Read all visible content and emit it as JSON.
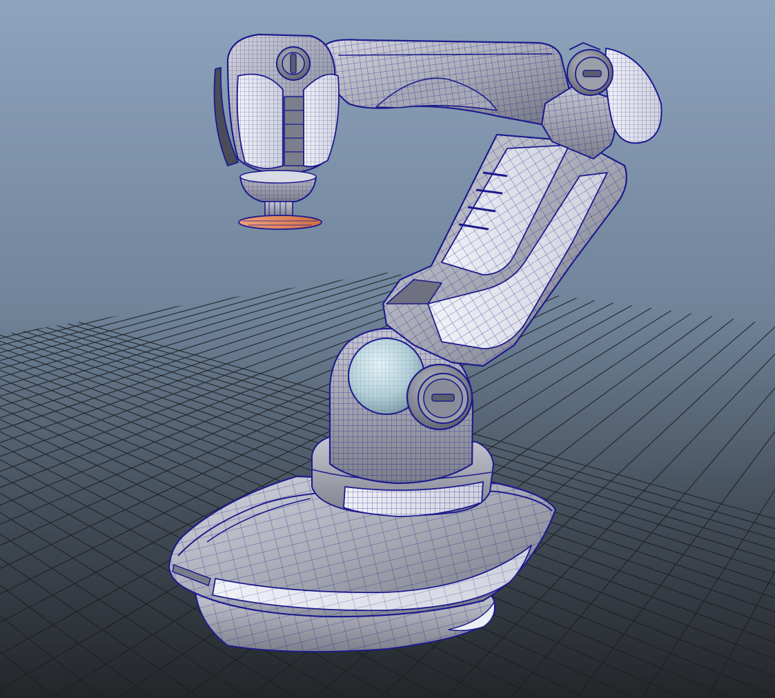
{
  "viewport": {
    "background_top": "#8ea4bd",
    "background_bottom": "#232629",
    "grid_color": "#1c1e20",
    "wire_color": "#1c1a8c",
    "surface_light": "#c9cad3",
    "surface_mid": "#a9abb6",
    "surface_dark": "#6f7180",
    "highlight_color": "#eef0f8",
    "joint_ball_color": "#b8d6dc",
    "selected_face_color": "#e0875f"
  },
  "model": {
    "object": "robotic-arm",
    "display_mode": "wireframe-on-shaded",
    "grid_visible": true
  }
}
